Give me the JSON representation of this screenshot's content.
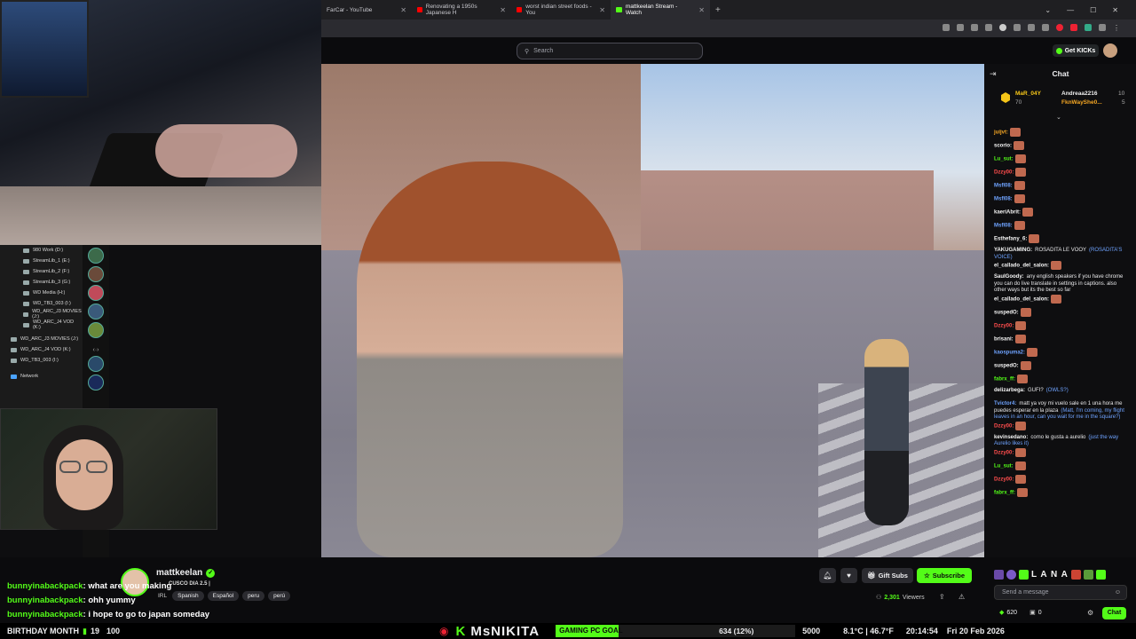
{
  "tabs": [
    {
      "label": "FarCar - YouTube",
      "color": "#ff0000"
    },
    {
      "label": "Renovating a 1950s Japanese H",
      "color": "#ff0000"
    },
    {
      "label": "worst indian street foods - You",
      "color": "#ff0000"
    },
    {
      "label": "mattkeelan Stream - Watch",
      "color": "#53fc18"
    }
  ],
  "search": {
    "placeholder": "Search"
  },
  "header": {
    "get_kicks": "Get KICKs"
  },
  "explorer": {
    "drives": [
      "980 Work (D:)",
      "StreamLib_1 (E:)",
      "StreamLib_2 (F:)",
      "StreamLib_3 (G:)",
      "WD Media (H:)",
      "WD_TB3_003 (I:)",
      "WD_ARC_J3 MOVIES (J:)",
      "WD_ARC_J4 VOD (K:)",
      "WD_ARC_J3 MOVIES (J:)",
      "WD_ARC_J4 VOD (K:)",
      "WD_TB3_003 (I:)",
      "Network"
    ]
  },
  "chat": {
    "title": "Chat",
    "leaders": [
      {
        "name": "MaR_04Y",
        "count": "70"
      },
      {
        "name": "Andreaa2216",
        "count": "10"
      },
      {
        "name": "FknWayShe0...",
        "count": "5"
      }
    ],
    "messages": [
      {
        "user": "juijvt:",
        "text": "",
        "color": "#f5a623",
        "emote": true
      },
      {
        "user": "scorio:",
        "text": "",
        "color": "#f5f5f5",
        "emote": true
      },
      {
        "user": "Lu_sut:",
        "text": "",
        "color": "#53fc18",
        "emote": true
      },
      {
        "user": "Dzzy00:",
        "text": "",
        "color": "#ff4d4d",
        "emote": true
      },
      {
        "user": "Msfl08:",
        "text": "",
        "color": "#6fa3ff",
        "emote": true
      },
      {
        "user": "Msfl08:",
        "text": "",
        "color": "#6fa3ff",
        "emote": true
      },
      {
        "user": "kaeriAbrit:",
        "text": "",
        "color": "#f5f5f5",
        "emote": true
      },
      {
        "user": "Msfl08:",
        "text": "",
        "color": "#6fa3ff",
        "emote": true
      },
      {
        "user": "Esthefany_6:",
        "text": "",
        "color": "#f5f5f5",
        "emote": true
      },
      {
        "user": "YAKUGAMING:",
        "text": "ROSADITA LE VOOY",
        "trans": "(ROSADITA'S VOICE)",
        "color": "#f5f5f5",
        "emote": false
      },
      {
        "user": "el_callado_del_salon:",
        "text": "",
        "color": "#f5f5f5",
        "emote": true
      },
      {
        "user": "SaulGoody:",
        "text": "any english speakers if you have chrome you can do live translate in settings in captions. also other ways but its the best so far",
        "color": "#f5f5f5",
        "emote": false
      },
      {
        "user": "el_callado_del_salon:",
        "text": "",
        "color": "#f5f5f5",
        "emote": true
      },
      {
        "user": "suspedO:",
        "text": "",
        "color": "#f5f5f5",
        "emote": true
      },
      {
        "user": "Dzzy00:",
        "text": "",
        "color": "#ff4d4d",
        "emote": true
      },
      {
        "user": "brisani:",
        "text": "",
        "color": "#f5f5f5",
        "emote": true
      },
      {
        "user": "kaospuma2:",
        "text": "",
        "color": "#6fa3ff",
        "emote": true
      },
      {
        "user": "suspedO:",
        "text": "",
        "color": "#f5f5f5",
        "emote": true
      },
      {
        "user": "fabrx_ff:",
        "text": "",
        "color": "#53fc18",
        "emote": true
      },
      {
        "user": "delizarbega:",
        "text": "GUFI?",
        "trans": "(OWLS?)",
        "color": "#f5f5f5",
        "emote": false
      },
      {
        "user": "Tvictor4:",
        "text": "matt ya voy mi vuelo sale en 1 una hora me puedes esperar en la plaza",
        "trans": "(Matt, I'm coming, my flight leaves in an hour, can you wait for me in the square?)",
        "color": "#6fa3ff",
        "emote": false
      },
      {
        "user": "Dzzy00:",
        "text": "",
        "color": "#ff4d4d",
        "emote": true
      },
      {
        "user": "kevinsedano:",
        "text": "como le gusta a aurelio",
        "trans": "(just the way Aurelio likes it)",
        "color": "#f5f5f5",
        "emote": false
      },
      {
        "user": "Dzzy00:",
        "text": "",
        "color": "#ff4d4d",
        "emote": true
      },
      {
        "user": "Lu_sut:",
        "text": "",
        "color": "#53fc18",
        "emote": true
      },
      {
        "user": "Dzzy00:",
        "text": "",
        "color": "#ff4d4d",
        "emote": true
      },
      {
        "user": "fabrx_ff:",
        "text": "",
        "color": "#53fc18",
        "emote": true
      }
    ],
    "input_placeholder": "Send a message",
    "points": "620",
    "points_b": "0",
    "send_label": "Chat",
    "emote_strip": "L A N A"
  },
  "stream": {
    "channel": "mattkeelan",
    "title": "CUSCO DIA 2.5 |",
    "tags": [
      "IRL",
      "Spanish",
      "Español",
      "peru",
      "perú"
    ],
    "viewers": "2,301",
    "viewers_label": "Viewers",
    "gift_subs": "Gift Subs",
    "subscribe": "Subscribe"
  },
  "overlay_chat": [
    {
      "name": "bunnyinabackpack",
      "text": ": what are you making"
    },
    {
      "name": "bunnyinabackpack",
      "text": ": ohh yummy"
    },
    {
      "name": "bunnyinabackpack",
      "text": ": i hope to go to japan someday"
    }
  ],
  "ticker": {
    "month": "BIRTHDAY MONTH",
    "count_a": "19",
    "count_b": "100",
    "brand": "MsNIKITA",
    "goal_label": "GAMING PC GOAL",
    "goal_progress": "634 (12%)",
    "goal_pct": 12,
    "goal_total": "5000",
    "weather": "8.1°C | 46.7°F",
    "time": "20:14:54",
    "date": "Fri 20 Feb 2026"
  }
}
